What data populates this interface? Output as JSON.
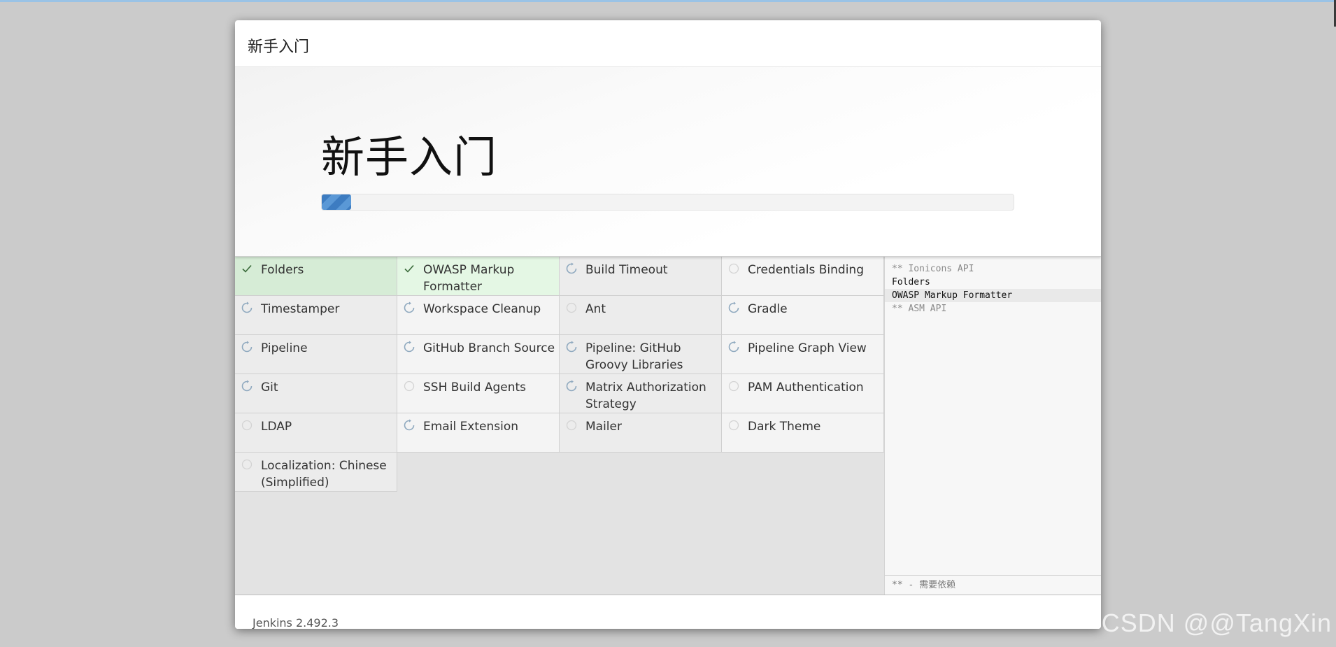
{
  "dialog": {
    "title": "新手入门",
    "hero_title": "新手入门",
    "progress": 0.042
  },
  "plugins": [
    {
      "name": "Folders",
      "status": "success"
    },
    {
      "name": "OWASP Markup Formatter",
      "status": "success"
    },
    {
      "name": "Build Timeout",
      "status": "installing"
    },
    {
      "name": "Credentials Binding",
      "status": "pending"
    },
    {
      "name": "Timestamper",
      "status": "installing"
    },
    {
      "name": "Workspace Cleanup",
      "status": "installing"
    },
    {
      "name": "Ant",
      "status": "pending"
    },
    {
      "name": "Gradle",
      "status": "installing"
    },
    {
      "name": "Pipeline",
      "status": "installing"
    },
    {
      "name": "GitHub Branch Source",
      "status": "installing"
    },
    {
      "name": "Pipeline: GitHub Groovy Libraries",
      "status": "installing"
    },
    {
      "name": "Pipeline Graph View",
      "status": "installing"
    },
    {
      "name": "Git",
      "status": "installing"
    },
    {
      "name": "SSH Build Agents",
      "status": "pending"
    },
    {
      "name": "Matrix Authorization Strategy",
      "status": "installing"
    },
    {
      "name": "PAM Authentication",
      "status": "pending"
    },
    {
      "name": "LDAP",
      "status": "pending"
    },
    {
      "name": "Email Extension",
      "status": "installing"
    },
    {
      "name": "Mailer",
      "status": "pending"
    },
    {
      "name": "Dark Theme",
      "status": "pending"
    },
    {
      "name": "Localization: Chinese (Simplified)",
      "status": "pending"
    }
  ],
  "log": {
    "lines": [
      {
        "text": "** Ionicons API",
        "dependency": true
      },
      {
        "text": "Folders",
        "dependency": false
      },
      {
        "text": "OWASP Markup Formatter",
        "dependency": false,
        "current": true
      },
      {
        "text": "** ASM API",
        "dependency": true
      }
    ],
    "footer": "** - 需要依赖"
  },
  "footer": {
    "version": "Jenkins 2.492.3"
  },
  "watermark": "CSDN @@TangXin",
  "colors": {
    "progress": "#3d7cc1",
    "success_cell": "#d6ecd6",
    "icon": "#7d9bb3"
  }
}
